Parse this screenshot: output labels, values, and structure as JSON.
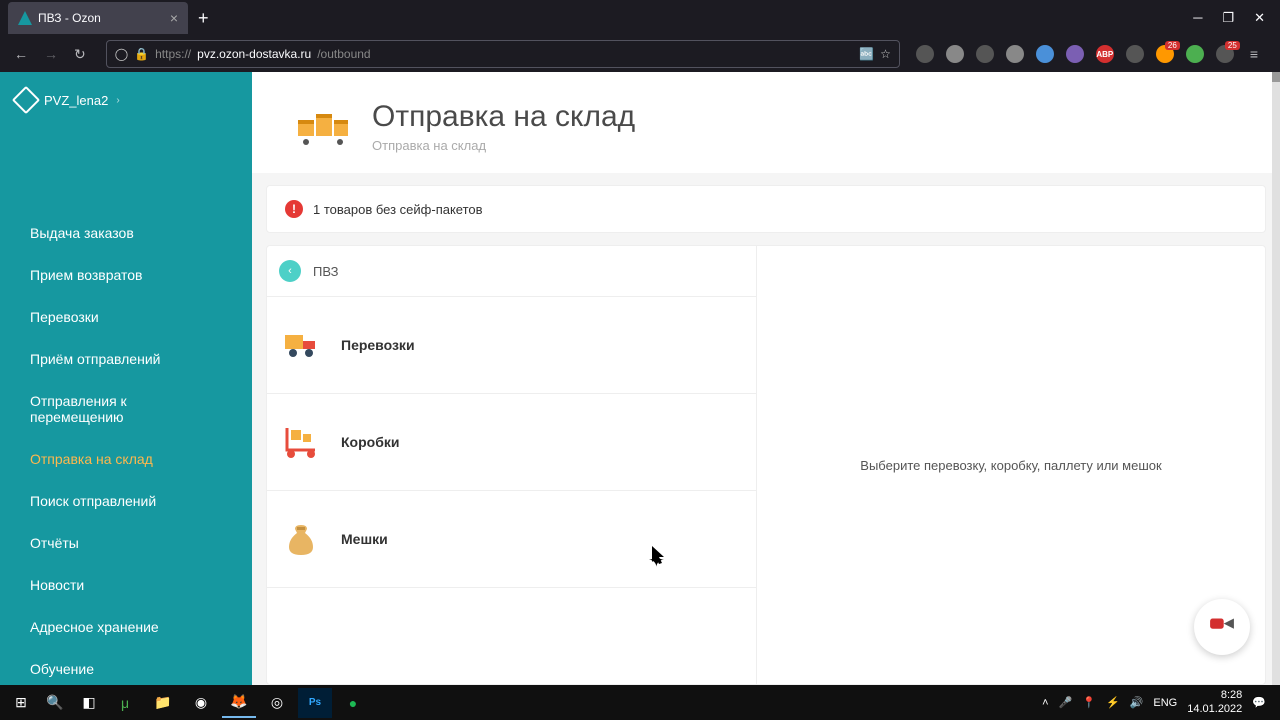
{
  "browser": {
    "tab_title": "ПВЗ - Ozon",
    "url_prefix": "https://",
    "url_host": "pvz.ozon-dostavka.ru",
    "url_path": "/outbound"
  },
  "sidebar": {
    "user": "PVZ_lena2",
    "items": [
      {
        "label": "Выдача заказов",
        "active": false
      },
      {
        "label": "Прием возвратов",
        "active": false
      },
      {
        "label": "Перевозки",
        "active": false
      },
      {
        "label": "Приём отправлений",
        "active": false
      },
      {
        "label": "Отправления к перемещению",
        "active": false
      },
      {
        "label": "Отправка на склад",
        "active": true
      },
      {
        "label": "Поиск отправлений",
        "active": false
      },
      {
        "label": "Отчёты",
        "active": false
      },
      {
        "label": "Новости",
        "active": false
      },
      {
        "label": "Адресное хранение",
        "active": false
      },
      {
        "label": "Обучение",
        "active": false
      }
    ]
  },
  "header": {
    "title": "Отправка на склад",
    "subtitle": "Отправка на склад"
  },
  "alert": {
    "count": "1",
    "text": "товаров без сейф-пакетов"
  },
  "list": {
    "header": "ПВЗ",
    "items": [
      {
        "label": "Перевозки",
        "icon": "truck"
      },
      {
        "label": "Коробки",
        "icon": "dolly"
      },
      {
        "label": "Мешки",
        "icon": "sack"
      }
    ]
  },
  "detail": {
    "empty_text": "Выберите перевозку, коробку, паллету или мешок"
  },
  "taskbar": {
    "lang": "ENG",
    "time": "8:28",
    "date": "14.01.2022"
  },
  "ext_badges": {
    "b1": "26",
    "b2": "25"
  }
}
